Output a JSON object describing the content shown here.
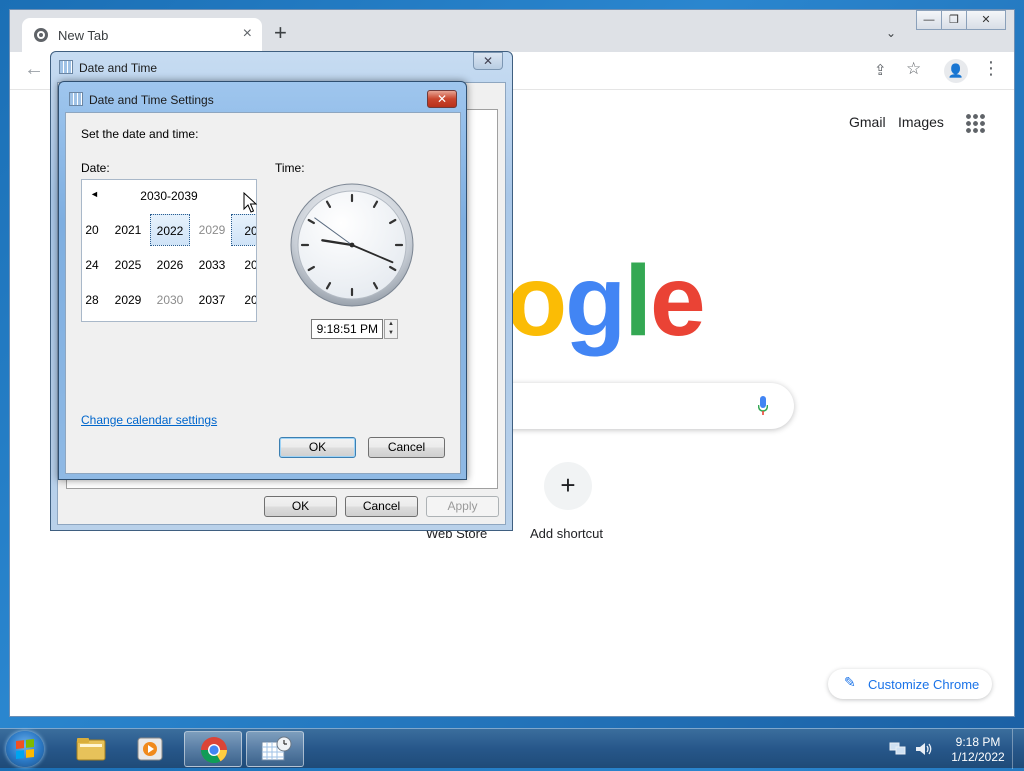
{
  "browser": {
    "tab_title": "New Tab",
    "tab_close": "×",
    "new_tab": "+",
    "tab_search": "⌄",
    "win_minimize": "—",
    "win_restore": "❐",
    "win_close": "✕",
    "back": "←",
    "share": "⇪",
    "star": "☆",
    "profile": "👤",
    "menu": "⋮"
  },
  "newtab": {
    "gmail": "Gmail",
    "images": "Images",
    "logo": [
      "o",
      "g",
      "l",
      "e"
    ],
    "add_shortcut_icon": "+",
    "add_shortcut_label": "Add shortcut",
    "web_store_label": "Web Store",
    "customize_label": "Customize Chrome",
    "customize_icon": "✎"
  },
  "dt_dialog": {
    "title": "Date and Time",
    "close": "✕",
    "ok": "OK",
    "cancel": "Cancel",
    "apply": "Apply"
  },
  "settings_dialog": {
    "title": "Date and Time Settings",
    "close": "✕",
    "instruction": "Set the date and time:",
    "date_label": "Date:",
    "time_label": "Time:",
    "calendar_header": "2030-2039",
    "calendar_prev": "◄",
    "calendar_rows": [
      [
        "20",
        "2021",
        "2022",
        "2029",
        "20"
      ],
      [
        "24",
        "2025",
        "2026",
        "2033",
        "20"
      ],
      [
        "28",
        "2029",
        "2030",
        "2037",
        "20"
      ]
    ],
    "time_value": "9:18:51 PM",
    "spin_up": "▲",
    "spin_down": "▼",
    "change_calendar_link": "Change calendar settings",
    "ok": "OK",
    "cancel": "Cancel"
  },
  "taskbar": {
    "tray_time": "9:18 PM",
    "tray_date": "1/12/2022",
    "pinned": [
      "explorer-icon",
      "media-player-icon",
      "chrome-icon",
      "date-time-icon"
    ]
  },
  "colors": {
    "google_blue": "#4285f4",
    "google_red": "#ea4335",
    "google_yellow": "#fbbc05",
    "google_green": "#34a853",
    "link": "#0066cc"
  }
}
